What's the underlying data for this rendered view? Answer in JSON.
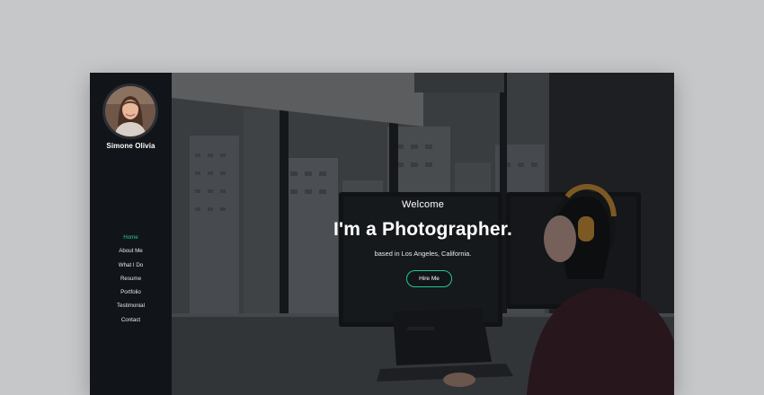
{
  "sidebar": {
    "name": "Simone Olivia",
    "nav": [
      {
        "label": "Home",
        "active": true
      },
      {
        "label": "About Me",
        "active": false
      },
      {
        "label": "What I Do",
        "active": false
      },
      {
        "label": "Resume",
        "active": false
      },
      {
        "label": "Portfolio",
        "active": false
      },
      {
        "label": "Testimonial",
        "active": false
      },
      {
        "label": "Contact",
        "active": false
      }
    ]
  },
  "hero": {
    "welcome": "Welcome",
    "headline": "I'm a Photographer.",
    "subtext": "based in Los Angeles, California.",
    "button_label": "Hire Me"
  },
  "colors": {
    "accent": "#20c997",
    "sidebar_bg": "#111418",
    "page_bg": "#c6c7c9"
  }
}
